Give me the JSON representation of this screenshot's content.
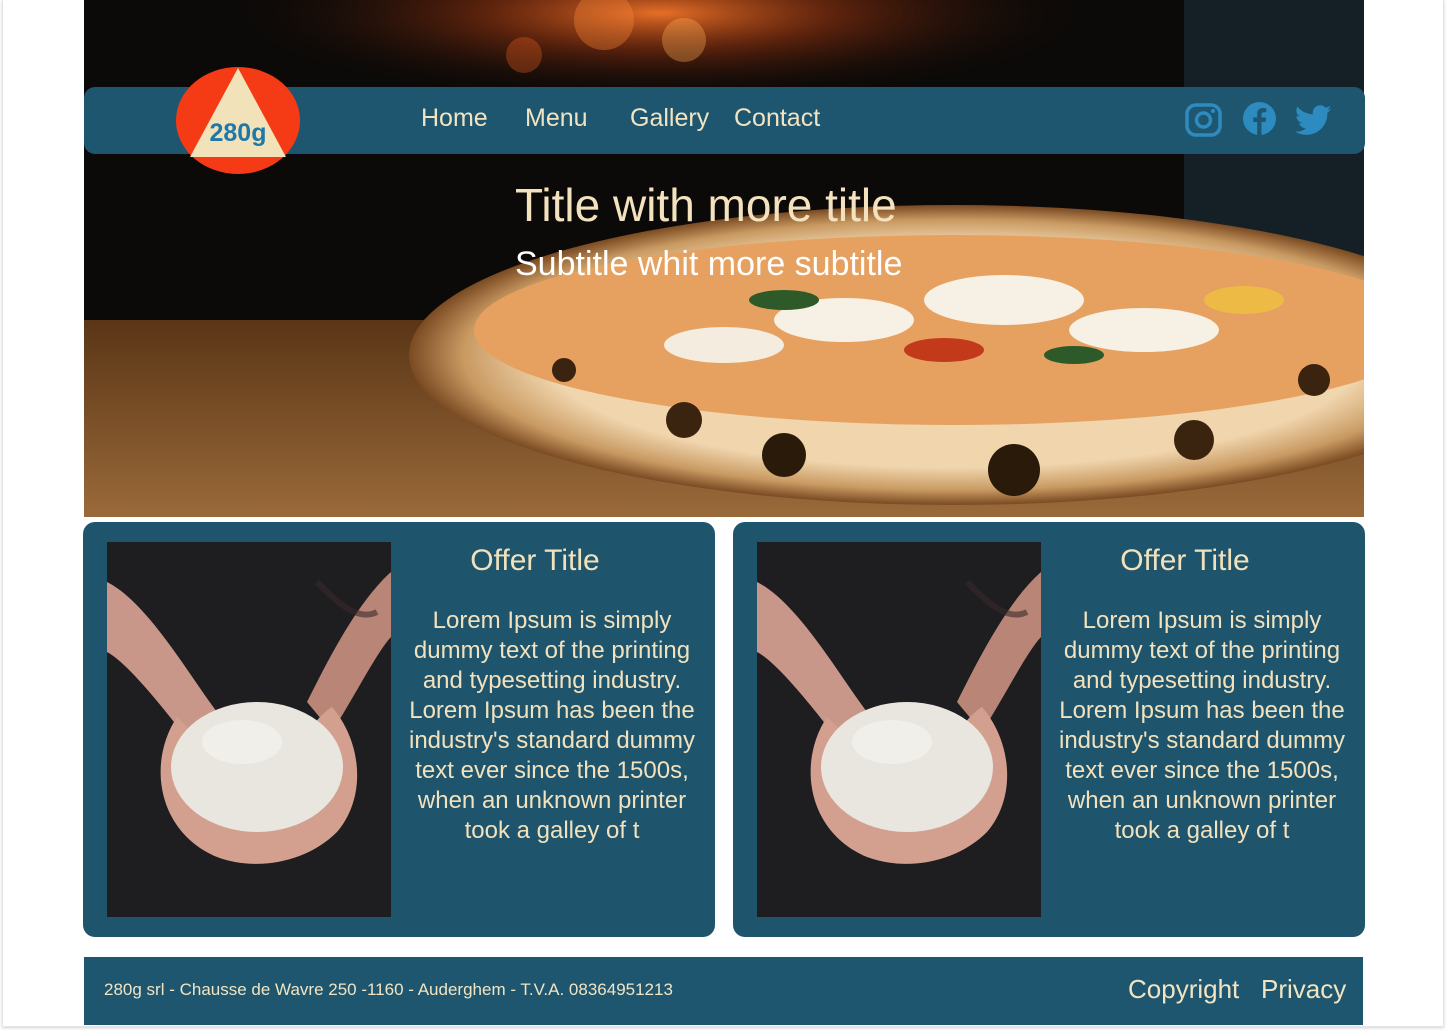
{
  "brand": {
    "logo_text": "280g",
    "colors": {
      "navbar": "#1f566f",
      "cream": "#f1e4c3",
      "logo_red": "#f53a16",
      "logo_triangle": "#f2e2ba",
      "icon_blue": "#2d8bc0"
    }
  },
  "nav": {
    "links": [
      "Home",
      "Menu",
      "Gallery",
      "Contact"
    ],
    "social_icons": [
      "instagram-icon",
      "facebook-icon",
      "twitter-icon"
    ]
  },
  "hero": {
    "title": "Title with more title",
    "subtitle": "Subtitle whit more subtitle",
    "image": "pizza-photo"
  },
  "offers": [
    {
      "title": "Offer Title",
      "text": "Lorem Ipsum is simply dummy text of the printing and typesetting industry. Lorem Ipsum has been the industry's standard dummy text ever since the 1500s, when an unknown printer took a galley of t",
      "image": "dough-ball-photo"
    },
    {
      "title": "Offer Title",
      "text": "Lorem Ipsum is simply dummy text of the printing and typesetting industry. Lorem Ipsum has been the industry's standard dummy text ever since the 1500s, when an unknown printer took a galley of t",
      "image": "dough-ball-photo"
    }
  ],
  "footer": {
    "address": "280g srl - Chausse de Wavre 250 -1160 - Auderghem - T.V.A. 08364951213",
    "links": [
      "Copyright",
      "Privacy"
    ]
  }
}
